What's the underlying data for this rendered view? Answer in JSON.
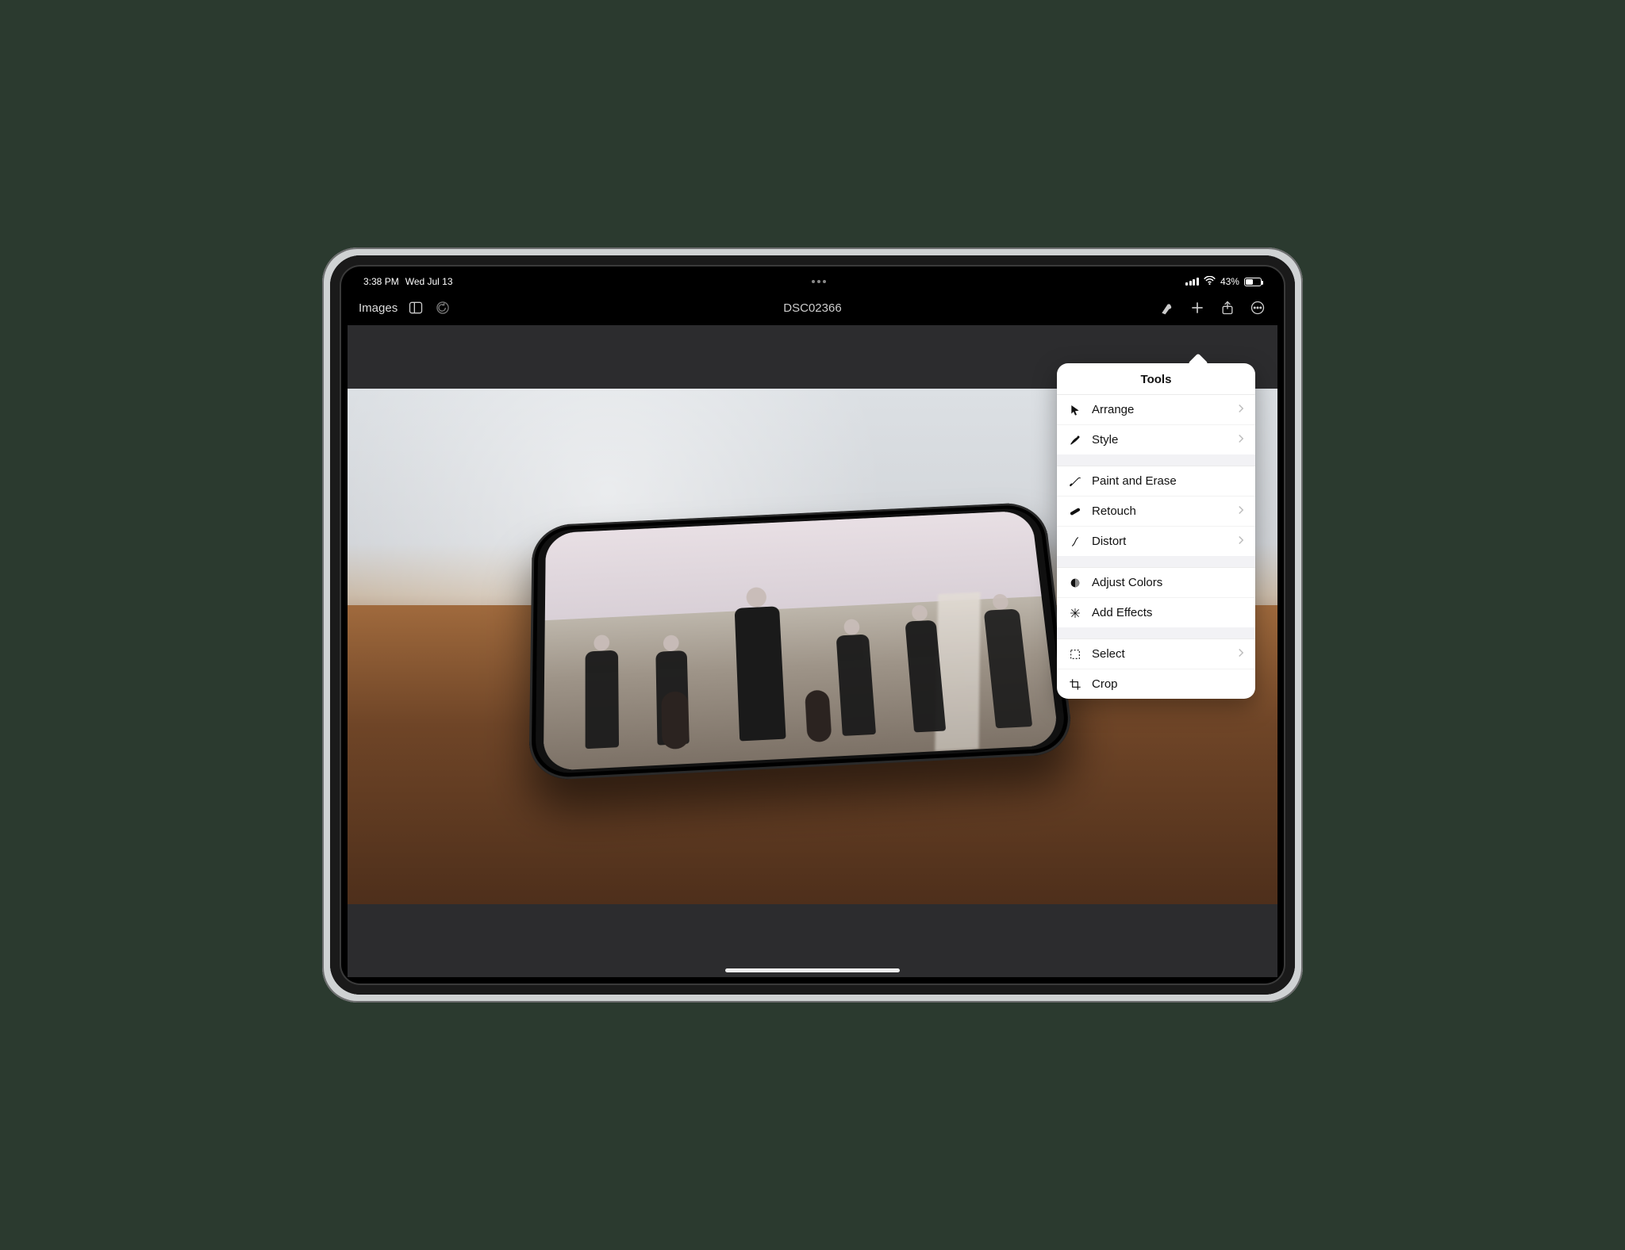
{
  "status": {
    "time": "3:38 PM",
    "date": "Wed Jul 13",
    "battery_percent": "43%",
    "battery_level_pct": 43
  },
  "toolbar": {
    "back_label": "Images",
    "title": "DSC02366"
  },
  "popover": {
    "title": "Tools",
    "groups": [
      [
        {
          "icon": "cursor-icon",
          "label": "Arrange",
          "chevron": true
        },
        {
          "icon": "style-icon",
          "label": "Style",
          "chevron": true
        }
      ],
      [
        {
          "icon": "brush-icon",
          "label": "Paint and Erase",
          "chevron": false
        },
        {
          "icon": "bandage-icon",
          "label": "Retouch",
          "chevron": true
        },
        {
          "icon": "distort-icon",
          "label": "Distort",
          "chevron": true
        }
      ],
      [
        {
          "icon": "adjust-icon",
          "label": "Adjust Colors",
          "chevron": false
        },
        {
          "icon": "effects-icon",
          "label": "Add Effects",
          "chevron": false
        }
      ],
      [
        {
          "icon": "select-icon",
          "label": "Select",
          "chevron": true
        },
        {
          "icon": "crop-icon",
          "label": "Crop",
          "chevron": false
        }
      ]
    ]
  }
}
